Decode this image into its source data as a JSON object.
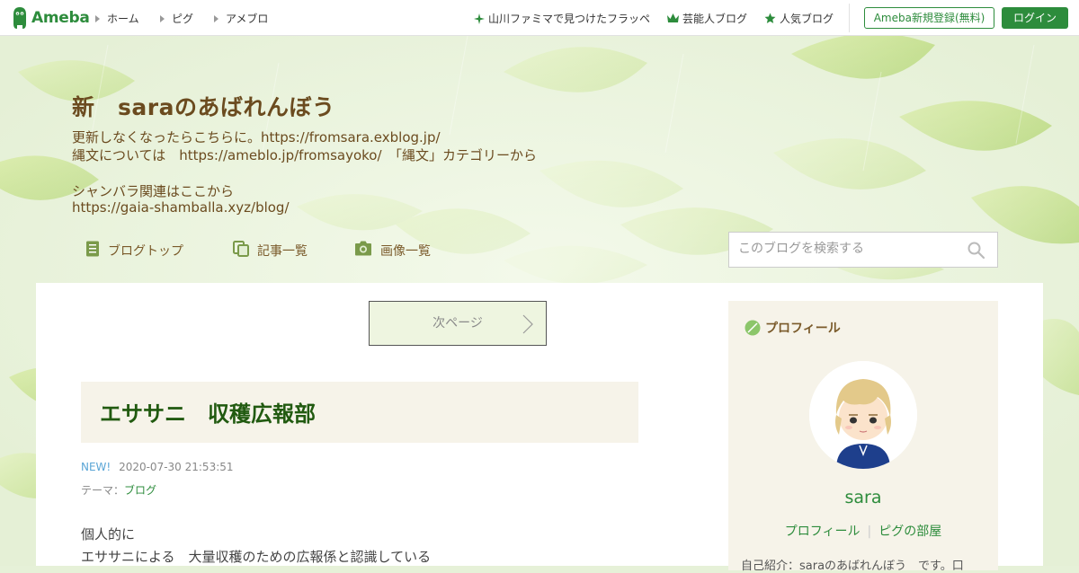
{
  "topbar": {
    "logo_text": "Ameba",
    "nav": [
      "ホーム",
      "ピグ",
      "アメブロ"
    ],
    "links": [
      {
        "label": "山川ファミマで見つけたフラッペ",
        "icon": "sparkle-icon"
      },
      {
        "label": "芸能人ブログ",
        "icon": "crown-icon"
      },
      {
        "label": "人気ブログ",
        "icon": "star-icon"
      }
    ],
    "register_label": "Ameba新規登録(無料)",
    "login_label": "ログイン",
    "accent_color": "#2d8c3c"
  },
  "blog": {
    "title": "新　saraのあばれんぼう",
    "description": [
      "更新しなくなったらこちらに。https://fromsara.exblog.jp/",
      "縄文については　https://ameblo.jp/fromsayoko/　「縄文」カテゴリーから",
      "シャンバラ関連はここから",
      "https://gaia-shamballa.xyz/blog/"
    ],
    "nav": [
      {
        "label": "ブログトップ",
        "icon": "document-icon"
      },
      {
        "label": "記事一覧",
        "icon": "copy-icon"
      },
      {
        "label": "画像一覧",
        "icon": "camera-icon"
      }
    ],
    "search_placeholder": "このブログを検索する"
  },
  "main": {
    "next_page_label": "次ページ",
    "entry": {
      "title": "エササニ　収穫広報部",
      "new_badge": "NEW!",
      "datetime": "2020-07-30 21:53:51",
      "theme_prefix": "テーマ：",
      "theme": "ブログ",
      "body": [
        "個人的に",
        "エササニによる　大量収穫のための広報係と認識している"
      ]
    }
  },
  "profile": {
    "heading": "プロフィール",
    "name": "sara",
    "links": [
      "プロフィール",
      "ピグの部屋"
    ],
    "intro": "自己紹介：saraのあばれんぼう　です。口"
  }
}
